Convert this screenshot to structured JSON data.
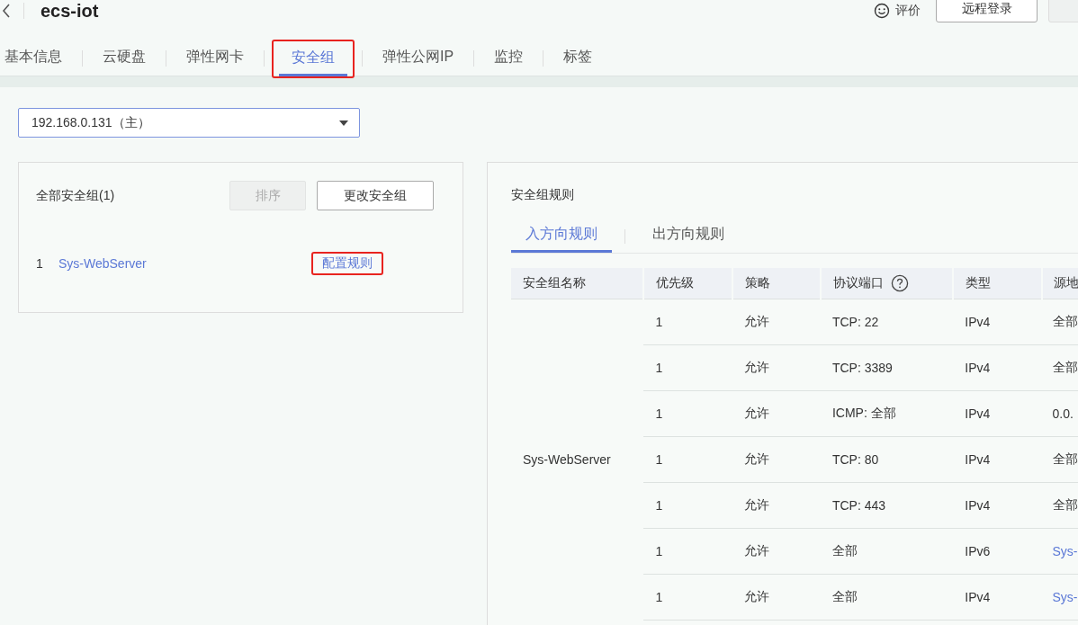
{
  "header": {
    "title": "ecs-iot",
    "feedback": "评价",
    "buttons": [
      {
        "label": "远程登录",
        "kind": "normal"
      },
      {
        "kind": "cut"
      }
    ]
  },
  "tabs": [
    {
      "label": "基本信息",
      "selected": false,
      "highlighted": false
    },
    {
      "label": "云硬盘",
      "selected": false,
      "highlighted": false
    },
    {
      "label": "弹性网卡",
      "selected": false,
      "highlighted": false
    },
    {
      "label": "安全组",
      "selected": true,
      "highlighted": true
    },
    {
      "label": "弹性公网IP",
      "selected": false,
      "highlighted": false
    },
    {
      "label": "监控",
      "selected": false,
      "highlighted": false
    },
    {
      "label": "标签",
      "selected": false,
      "highlighted": false
    }
  ],
  "nic_select": {
    "value": "192.168.0.131（主）"
  },
  "groups_card": {
    "title": "全部安全组(1)",
    "buttons": [
      {
        "label": "排序",
        "disabled": true
      },
      {
        "label": "更改安全组",
        "disabled": false
      }
    ],
    "items": [
      {
        "index": "1",
        "name": "Sys-WebServer",
        "action": "配置规则",
        "action_highlighted": true
      }
    ]
  },
  "rules_panel": {
    "title": "安全组规则",
    "tabs": [
      {
        "label": "入方向规则",
        "selected": true
      },
      {
        "label": "出方向规则",
        "selected": false
      }
    ],
    "columns": [
      "安全组名称",
      "优先级",
      "策略",
      "协议端口",
      "类型",
      "源地"
    ],
    "group_name": "Sys-WebServer",
    "rows": [
      {
        "kind": "text",
        "priority": "1",
        "policy": "允许",
        "port": "TCP: 22",
        "type": "IPv4",
        "source": "全部"
      },
      {
        "kind": "text",
        "priority": "1",
        "policy": "允许",
        "port": "TCP: 3389",
        "type": "IPv4",
        "source": "全部"
      },
      {
        "kind": "text",
        "priority": "1",
        "policy": "允许",
        "port": "ICMP: 全部",
        "type": "IPv4",
        "source": "0.0."
      },
      {
        "kind": "text",
        "priority": "1",
        "policy": "允许",
        "port": "TCP: 80",
        "type": "IPv4",
        "source": "全部"
      },
      {
        "kind": "text",
        "priority": "1",
        "policy": "允许",
        "port": "TCP: 443",
        "type": "IPv4",
        "source": "全部"
      },
      {
        "kind": "link",
        "priority": "1",
        "policy": "允许",
        "port": "全部",
        "type": "IPv6",
        "source": "Sys-"
      },
      {
        "kind": "link",
        "priority": "1",
        "policy": "允许",
        "port": "全部",
        "type": "IPv4",
        "source": "Sys-"
      }
    ]
  }
}
